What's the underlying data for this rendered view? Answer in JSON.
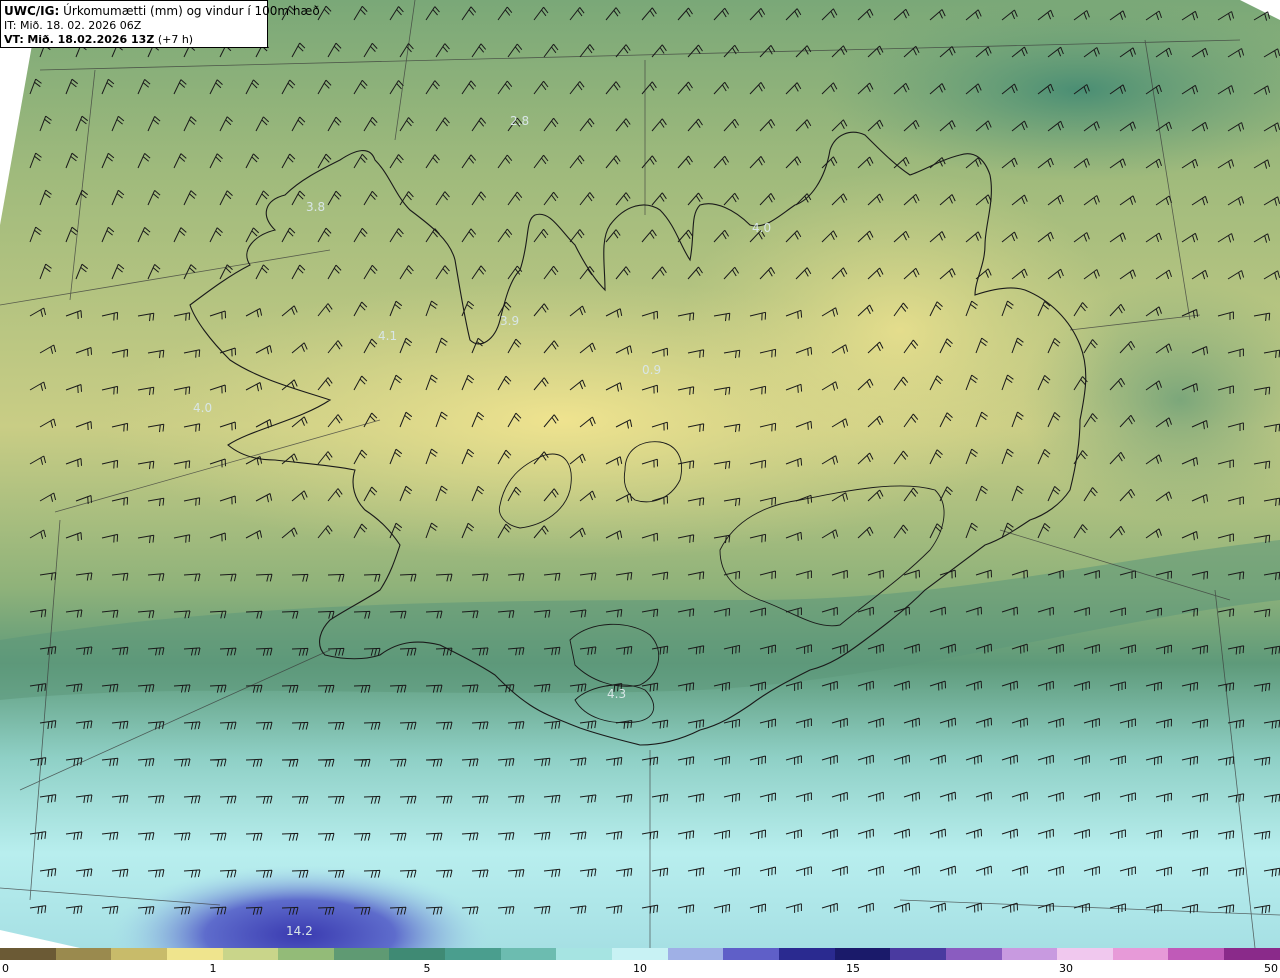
{
  "header": {
    "model_prefix": "UWC/IG:",
    "title": "Úrkomumætti (mm) og vindur í 100m hæð",
    "init_prefix": "IT:",
    "init_time": "Mið. 18. 02. 2026 06Z",
    "valid_prefix": "VT:",
    "valid_time": "Mið. 18.02.2026 13Z",
    "lead": "(+7 h)"
  },
  "map_labels": [
    {
      "text": "2.8"
    },
    {
      "text": "3.8"
    },
    {
      "text": "4.0"
    },
    {
      "text": "4.1"
    },
    {
      "text": "3.9"
    },
    {
      "text": "4.0"
    },
    {
      "text": "0.9"
    },
    {
      "text": "4.3"
    },
    {
      "text": "14.2"
    }
  ],
  "colorbar": {
    "ticks": [
      "0",
      "1",
      "5",
      "10",
      "15",
      "30",
      "50"
    ],
    "colors": [
      "#6b5a35",
      "#9a8a4e",
      "#c8bb6a",
      "#efe48d",
      "#c9d58a",
      "#93bb78",
      "#5f9a73",
      "#3f8a74",
      "#4a9e8e",
      "#6cbcb0",
      "#a6e4e2",
      "#c8f2f4",
      "#9fb0e6",
      "#5f5fc8",
      "#2a2a90",
      "#1a1a6a",
      "#4a3aa0",
      "#8a5cc0",
      "#c89ae0",
      "#f0c8ee",
      "#e79ad8",
      "#c05ab8",
      "#8a2a8a"
    ]
  },
  "colors": {
    "dry": "#e9e08c",
    "moderate": "#6fa67a",
    "wet": "#b6ecec",
    "heavy": "#3f3fb0"
  }
}
